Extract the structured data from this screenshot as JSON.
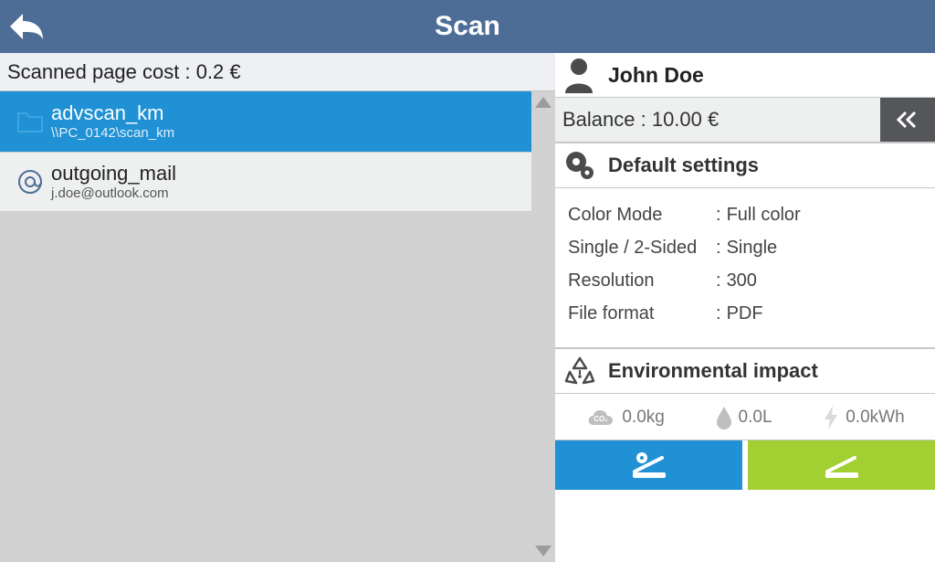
{
  "header": {
    "title": "Scan"
  },
  "cost_label": "Scanned page cost : 0.2 €",
  "destinations": [
    {
      "name": "advscan_km",
      "detail": "\\\\PC_0142\\scan_km",
      "icon": "folder-icon",
      "selected": true
    },
    {
      "name": "outgoing_mail",
      "detail": "j.doe@outlook.com",
      "icon": "at-icon",
      "selected": false
    }
  ],
  "user": {
    "name": "John Doe",
    "balance_label": "Balance : 10.00 €"
  },
  "sections": {
    "settings_title": "Default settings",
    "env_title": "Environmental impact"
  },
  "settings": {
    "rows": [
      {
        "label": "Color Mode",
        "value": "Full color"
      },
      {
        "label": "Single / 2-Sided",
        "value": "Single"
      },
      {
        "label": "Resolution",
        "value": "300"
      },
      {
        "label": "File format",
        "value": "PDF"
      }
    ]
  },
  "environment": {
    "co2": "0.0kg",
    "water": "0.0L",
    "energy": "0.0kWh"
  }
}
